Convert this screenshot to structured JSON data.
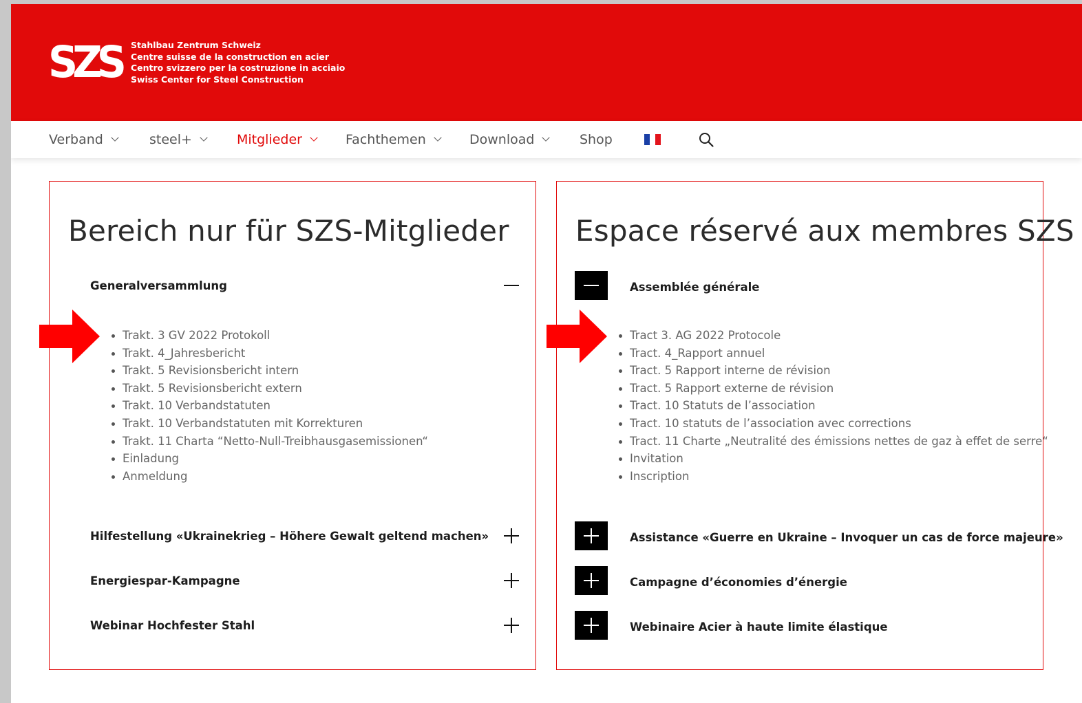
{
  "header": {
    "logo_mark": "SZS",
    "logo_lines": [
      "Stahlbau Zentrum Schweiz",
      "Centre suisse de la construction en acier",
      "Centro svizzero per la costruzione in acciaio",
      "Swiss Center for Steel Construction"
    ]
  },
  "nav": {
    "items": [
      {
        "label": "Verband",
        "has_dropdown": true
      },
      {
        "label": "steel+",
        "has_dropdown": true
      },
      {
        "label": "Mitglieder",
        "has_dropdown": true,
        "active": true
      },
      {
        "label": "Fachthemen",
        "has_dropdown": true
      },
      {
        "label": "Download",
        "has_dropdown": true
      },
      {
        "label": "Shop",
        "has_dropdown": false
      }
    ],
    "flag_icon": "france-flag-icon",
    "search_icon": "search-icon"
  },
  "colors": {
    "brand_red": "#e10a0a",
    "flag_blue": "#1a3fa6",
    "flag_white": "#ffffff",
    "flag_red": "#e3141c"
  },
  "left": {
    "title": "Bereich nur für SZS-Mitglieder",
    "sections": [
      {
        "title": "Generalversammlung",
        "expanded": true,
        "items": [
          "Trakt. 3 GV 2022 Protokoll",
          "Trakt. 4_Jahresbericht",
          "Trakt. 5 Revisionsbericht intern",
          "Trakt. 5 Revisionsbericht extern",
          "Trakt. 10 Verbandstatuten",
          "Trakt. 10 Verbandstatuten mit Korrekturen",
          "Trakt. 11 Charta “Netto-Null-Treibhausgasemissionen“",
          "Einladung",
          "Anmeldung"
        ]
      },
      {
        "title": "Hilfestellung «Ukrainekrieg – Höhere Gewalt geltend machen»",
        "expanded": false
      },
      {
        "title": "Energiespar-Kampagne",
        "expanded": false
      },
      {
        "title": "Webinar Hochfester Stahl",
        "expanded": false
      }
    ]
  },
  "right": {
    "title": "Espace réservé aux membres SZS",
    "sections": [
      {
        "title": "Assemblée générale",
        "expanded": true,
        "items": [
          "Tract 3. AG 2022 Protocole",
          "Tract. 4_Rapport annuel",
          "Tract. 5 Rapport interne de révision",
          "Tract. 5 Rapport externe de révision",
          "Tract. 10 Statuts de l’association",
          "Tract. 10 statuts de l’association avec corrections",
          "Tract. 11 Charte „Neutralité des émissions nettes de gaz à effet de serre“",
          "Invitation",
          "Inscription"
        ]
      },
      {
        "title": "Assistance «Guerre en Ukraine – Invoquer un cas de force majeure»",
        "expanded": false
      },
      {
        "title": "Campagne d’économies d’énergie",
        "expanded": false
      },
      {
        "title": "Webinaire Acier à haute limite élastique",
        "expanded": false
      }
    ]
  }
}
